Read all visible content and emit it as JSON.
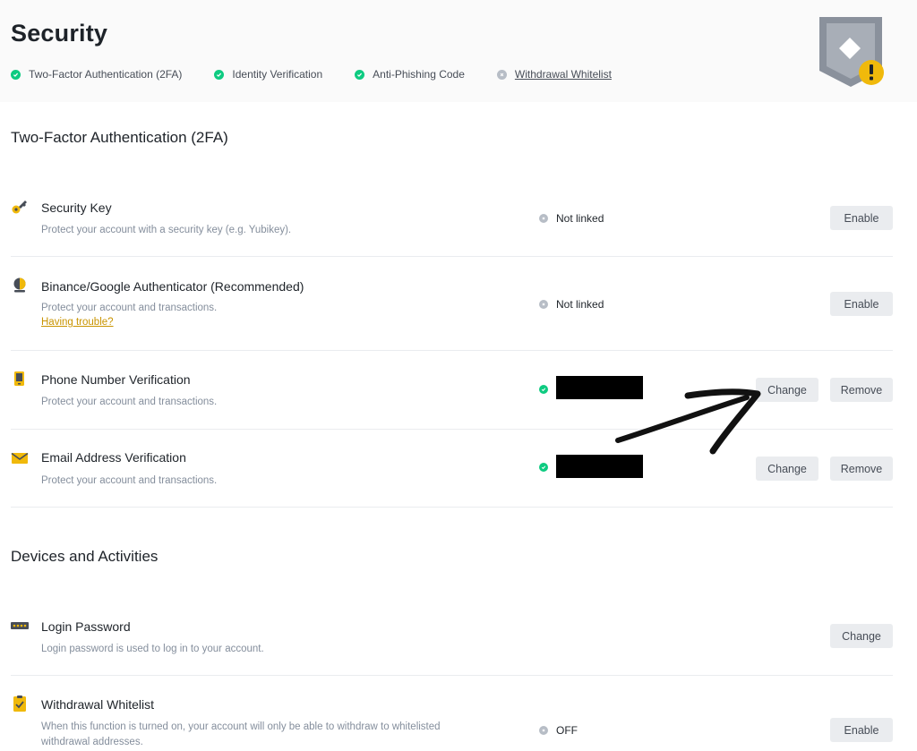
{
  "header": {
    "title": "Security",
    "checklist": [
      {
        "label": "Two-Factor Authentication (2FA)",
        "status": "done"
      },
      {
        "label": "Identity Verification",
        "status": "done"
      },
      {
        "label": "Anti-Phishing Code",
        "status": "done"
      },
      {
        "label": "Withdrawal Whitelist",
        "status": "pending"
      }
    ]
  },
  "colors": {
    "success": "#0ecb81",
    "neutral": "#b7bdc6",
    "brand_yellow": "#f0b90b",
    "link_yellow": "#c99400",
    "button_bg": "#eaecef"
  },
  "two_fa": {
    "title": "Two-Factor Authentication (2FA)",
    "items": [
      {
        "icon": "key-icon",
        "title": "Security Key",
        "description": "Protect your account with a security key (e.g. Yubikey).",
        "status": "Not linked",
        "status_type": "off",
        "buttons": [
          "Enable"
        ]
      },
      {
        "icon": "authenticator-icon",
        "title": "Binance/Google Authenticator (Recommended)",
        "description": "Protect your account and transactions.",
        "link": "Having trouble?",
        "status": "Not linked",
        "status_type": "off",
        "buttons": [
          "Enable"
        ]
      },
      {
        "icon": "phone-icon",
        "title": "Phone Number Verification",
        "description": "Protect your account and transactions.",
        "status_type": "on",
        "buttons": [
          "Change",
          "Remove"
        ]
      },
      {
        "icon": "email-icon",
        "title": "Email Address Verification",
        "description": "Protect your account and transactions.",
        "status_type": "on",
        "buttons": [
          "Change",
          "Remove"
        ]
      }
    ]
  },
  "devices": {
    "title": "Devices and Activities",
    "items": [
      {
        "icon": "password-icon",
        "title": "Login Password",
        "description": "Login password is used to log in to your account.",
        "buttons": [
          "Change"
        ]
      },
      {
        "icon": "whitelist-icon",
        "title": "Withdrawal Whitelist",
        "description_line1": "When this function is turned on, your account will only be able to withdraw to whitelisted",
        "description_line2": "withdrawal addresses.",
        "status": "OFF",
        "status_type": "off",
        "buttons": [
          "Enable"
        ]
      }
    ]
  }
}
